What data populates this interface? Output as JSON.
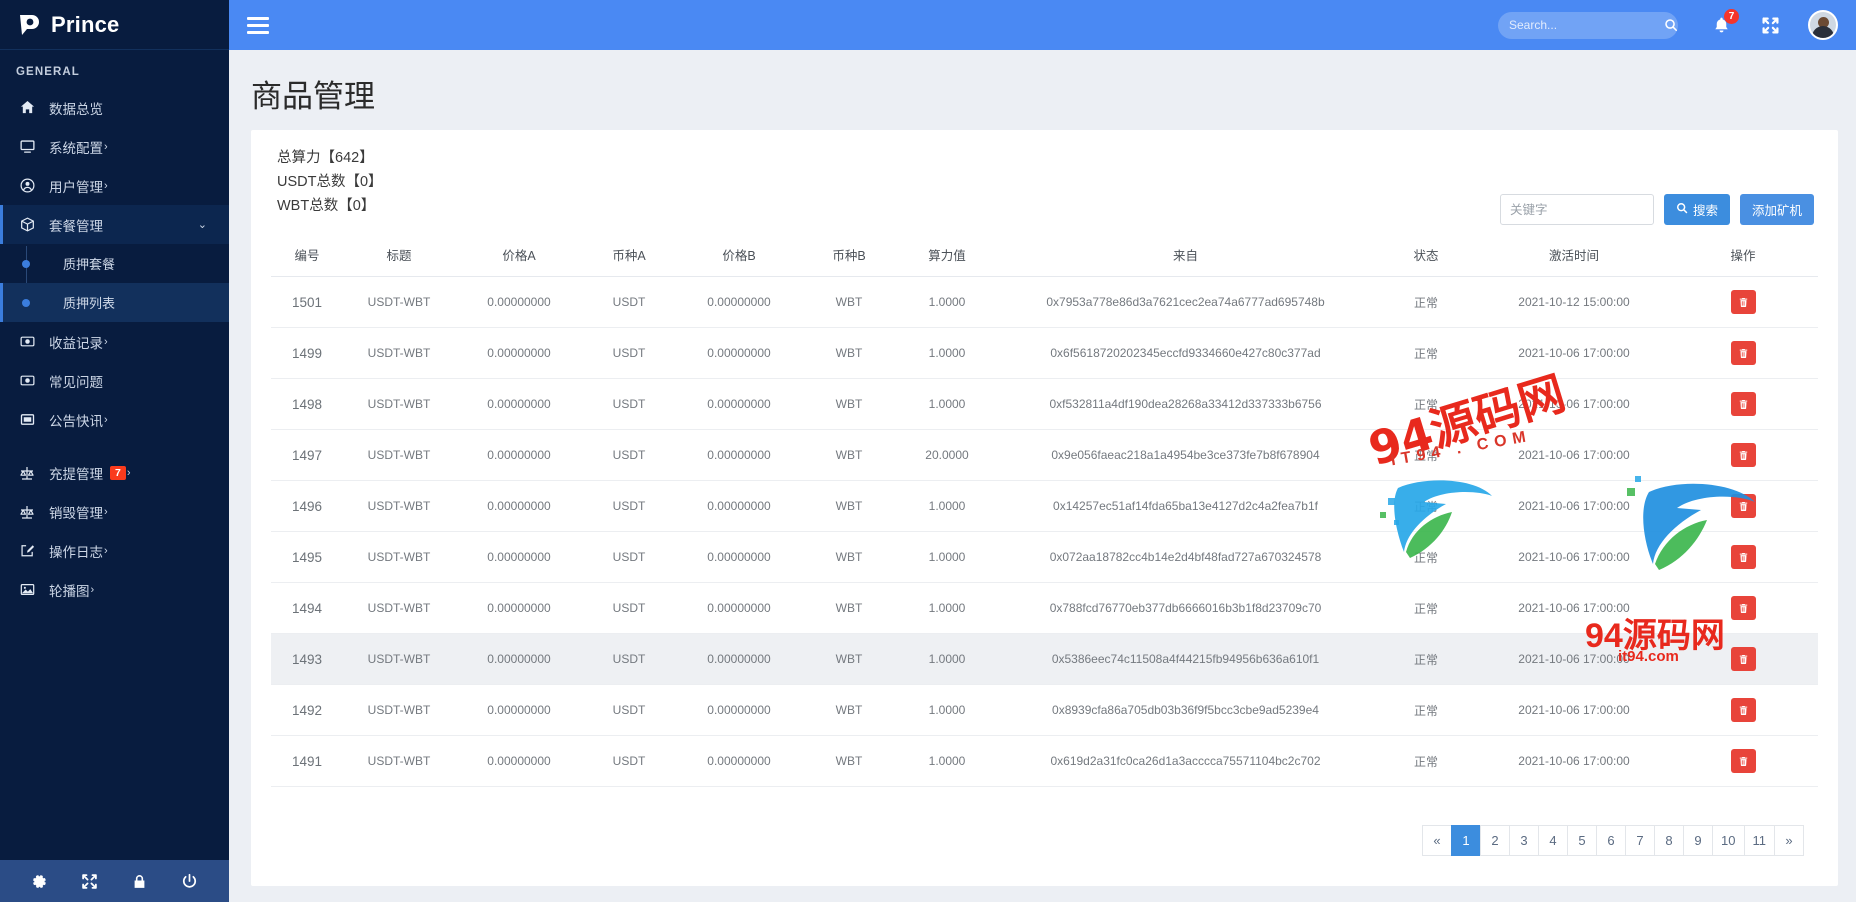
{
  "brand": {
    "name": "Prince",
    "logo_icon": "prince-p-logo"
  },
  "sidebar": {
    "section_label": "GENERAL",
    "items": [
      {
        "label": "数据总览",
        "icon": "home-icon",
        "caret": ""
      },
      {
        "label": "系统配置",
        "icon": "monitor-icon",
        "caret": "›"
      },
      {
        "label": "用户管理",
        "icon": "user-circle-icon",
        "caret": "›"
      },
      {
        "label": "套餐管理",
        "icon": "box-icon",
        "caret": ""
      },
      {
        "label": "收益记录",
        "icon": "coin-icon",
        "caret": "›"
      },
      {
        "label": "常见问题",
        "icon": "coin-icon",
        "caret": ""
      },
      {
        "label": "公告快讯",
        "icon": "window-icon",
        "caret": "›"
      },
      {
        "label": "充提管理",
        "icon": "scale-icon",
        "caret": "›",
        "badge": "7"
      },
      {
        "label": "销毁管理",
        "icon": "scale-icon",
        "caret": "›"
      },
      {
        "label": "操作日志",
        "icon": "edit-square-icon",
        "caret": "›"
      },
      {
        "label": "轮播图",
        "icon": "image-icon",
        "caret": "›"
      }
    ],
    "submenu": [
      {
        "label": "质押套餐"
      },
      {
        "label": "质押列表"
      }
    ],
    "footer_icons": [
      "gear-icon",
      "expand-icon",
      "lock-icon",
      "power-icon"
    ]
  },
  "topbar": {
    "menu_icon": "hamburger-icon",
    "search_placeholder": "Search...",
    "search_value": "",
    "search_icon": "search-icon",
    "bell_icon": "bell-icon",
    "bell_count": "7",
    "expand_icon": "fullscreen-icon",
    "avatar_icon": "user-avatar"
  },
  "page": {
    "title": "商品管理",
    "stats": [
      "总算力【642】",
      "USDT总数【0】",
      "WBT总数【0】"
    ]
  },
  "toolbar": {
    "keyword_placeholder": "关键字",
    "keyword_value": "",
    "search_label": "搜索",
    "search_icon": "search-icon",
    "add_label": "添加矿机"
  },
  "table": {
    "columns": [
      "编号",
      "标题",
      "价格A",
      "币种A",
      "价格B",
      "币种B",
      "算力值",
      "来自",
      "状态",
      "激活时间",
      "操作"
    ],
    "delete_icon": "trash-icon",
    "rows": [
      {
        "id": "1501",
        "title": "USDT-WBT",
        "priceA": "0.00000000",
        "coinA": "USDT",
        "priceB": "0.00000000",
        "coinB": "WBT",
        "power": "1.0000",
        "from": "0x7953a778e86d3a7621cec2ea74a6777ad695748b",
        "status": "正常",
        "time": "2021-10-12 15:00:00",
        "hovered": false
      },
      {
        "id": "1499",
        "title": "USDT-WBT",
        "priceA": "0.00000000",
        "coinA": "USDT",
        "priceB": "0.00000000",
        "coinB": "WBT",
        "power": "1.0000",
        "from": "0x6f5618720202345eccfd9334660e427c80c377ad",
        "status": "正常",
        "time": "2021-10-06 17:00:00",
        "hovered": false
      },
      {
        "id": "1498",
        "title": "USDT-WBT",
        "priceA": "0.00000000",
        "coinA": "USDT",
        "priceB": "0.00000000",
        "coinB": "WBT",
        "power": "1.0000",
        "from": "0xf532811a4df190dea28268a33412d337333b6756",
        "status": "正常",
        "time": "2021-10-06 17:00:00",
        "hovered": false
      },
      {
        "id": "1497",
        "title": "USDT-WBT",
        "priceA": "0.00000000",
        "coinA": "USDT",
        "priceB": "0.00000000",
        "coinB": "WBT",
        "power": "20.0000",
        "from": "0x9e056faeac218a1a4954be3ce373fe7b8f678904",
        "status": "正常",
        "time": "2021-10-06 17:00:00",
        "hovered": false
      },
      {
        "id": "1496",
        "title": "USDT-WBT",
        "priceA": "0.00000000",
        "coinA": "USDT",
        "priceB": "0.00000000",
        "coinB": "WBT",
        "power": "1.0000",
        "from": "0x14257ec51af14fda65ba13e4127d2c4a2fea7b1f",
        "status": "正常",
        "time": "2021-10-06 17:00:00",
        "hovered": false
      },
      {
        "id": "1495",
        "title": "USDT-WBT",
        "priceA": "0.00000000",
        "coinA": "USDT",
        "priceB": "0.00000000",
        "coinB": "WBT",
        "power": "1.0000",
        "from": "0x072aa18782cc4b14e2d4bf48fad727a670324578",
        "status": "正常",
        "time": "2021-10-06 17:00:00",
        "hovered": false
      },
      {
        "id": "1494",
        "title": "USDT-WBT",
        "priceA": "0.00000000",
        "coinA": "USDT",
        "priceB": "0.00000000",
        "coinB": "WBT",
        "power": "1.0000",
        "from": "0x788fcd76770eb377db6666016b3b1f8d23709c70",
        "status": "正常",
        "time": "2021-10-06 17:00:00",
        "hovered": false
      },
      {
        "id": "1493",
        "title": "USDT-WBT",
        "priceA": "0.00000000",
        "coinA": "USDT",
        "priceB": "0.00000000",
        "coinB": "WBT",
        "power": "1.0000",
        "from": "0x5386eec74c11508a4f44215fb94956b636a610f1",
        "status": "正常",
        "time": "2021-10-06 17:00:00",
        "hovered": true
      },
      {
        "id": "1492",
        "title": "USDT-WBT",
        "priceA": "0.00000000",
        "coinA": "USDT",
        "priceB": "0.00000000",
        "coinB": "WBT",
        "power": "1.0000",
        "from": "0x8939cfa86a705db03b36f9f5bcc3cbe9ad5239e4",
        "status": "正常",
        "time": "2021-10-06 17:00:00",
        "hovered": false
      },
      {
        "id": "1491",
        "title": "USDT-WBT",
        "priceA": "0.00000000",
        "coinA": "USDT",
        "priceB": "0.00000000",
        "coinB": "WBT",
        "power": "1.0000",
        "from": "0x619d2a31fc0ca26d1a3acccca75571104bc2c702",
        "status": "正常",
        "time": "2021-10-06 17:00:00",
        "hovered": false
      }
    ]
  },
  "pagination": {
    "prev": "«",
    "next": "»",
    "pages": [
      "1",
      "2",
      "3",
      "4",
      "5",
      "6",
      "7",
      "8",
      "9",
      "10",
      "11"
    ],
    "current": "1"
  },
  "watermark": {
    "main": "94源码网",
    "sub": "IT94 . COM",
    "bottom": "94源码网",
    "bottom_sub": "it94.com"
  },
  "colors": {
    "sidebar_bg": "#081c3f",
    "topbar_blue": "#4a89f3",
    "accent": "#3c8dde",
    "danger": "#e8443a",
    "badge_red": "#fa3b1d"
  }
}
